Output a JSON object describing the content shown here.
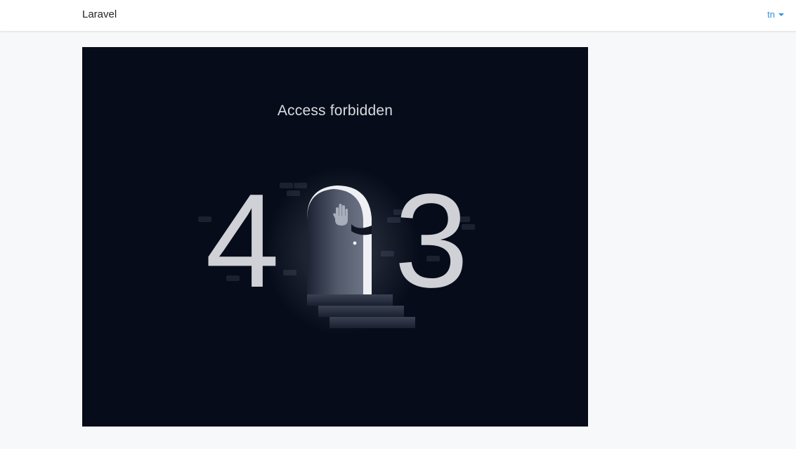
{
  "navbar": {
    "brand": "Laravel",
    "language": "tn",
    "language_caret_icon": "caret-down-icon"
  },
  "error": {
    "message": "Access forbidden",
    "code_first_digit": "4",
    "code_last_digit": "3",
    "illustration_icon": "locked-door-hand-icon"
  },
  "colors": {
    "panel_background": "#060c19",
    "digit": "#cfd1d6",
    "link": "#3490dc"
  }
}
